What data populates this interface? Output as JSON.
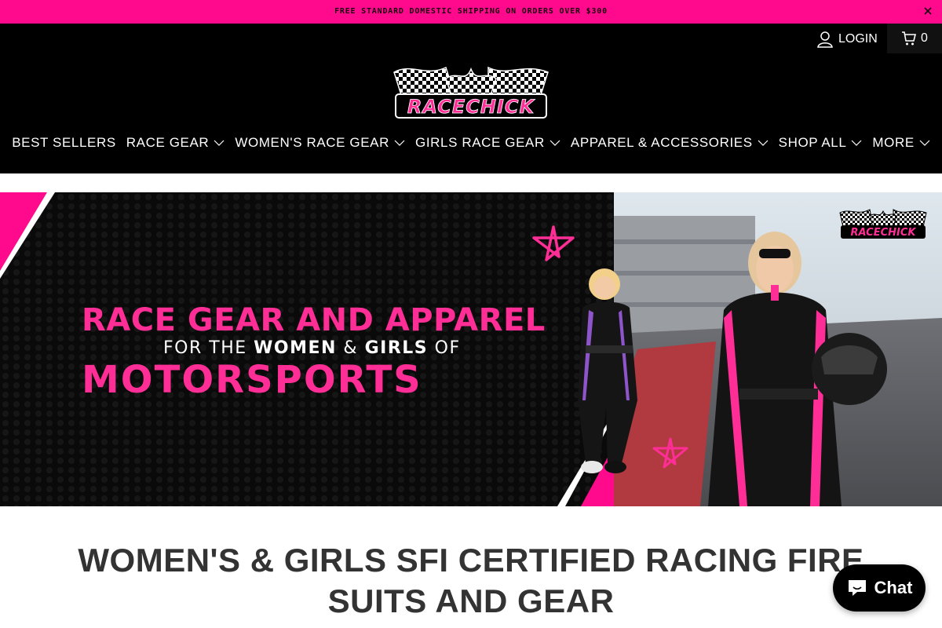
{
  "announcement": {
    "text": "FREE STANDARD DOMESTIC SHIPPING ON ORDERS OVER $300",
    "close_icon": "close-icon"
  },
  "header": {
    "login_label": "LOGIN",
    "cart_count": "0",
    "logo_text": "RACECHICK",
    "nav": [
      {
        "label": "BEST SELLERS",
        "dropdown": false
      },
      {
        "label": "RACE GEAR",
        "dropdown": true
      },
      {
        "label": "WOMEN'S RACE GEAR",
        "dropdown": true
      },
      {
        "label": "GIRLS RACE GEAR",
        "dropdown": true
      },
      {
        "label": "APPAREL & ACCESSORIES",
        "dropdown": true
      },
      {
        "label": "SHOP ALL",
        "dropdown": true
      },
      {
        "label": "MORE",
        "dropdown": true
      }
    ]
  },
  "hero": {
    "line1": "RACE GEAR AND APPAREL",
    "line2_a": "FOR THE ",
    "line2_b": "WOMEN",
    "line2_c": " & ",
    "line2_d": "GIRLS",
    "line2_e": " OF",
    "line3": "MOTORSPORTS",
    "logo_text": "RACECHICK"
  },
  "section": {
    "heading": "WOMEN'S & GIRLS SFI CERTIFIED RACING FIRE SUITS AND GEAR"
  },
  "chat": {
    "label": "Chat"
  },
  "colors": {
    "brand_pink": "#ff0a8c",
    "header_bg": "#000000",
    "heading_text": "#333333"
  }
}
